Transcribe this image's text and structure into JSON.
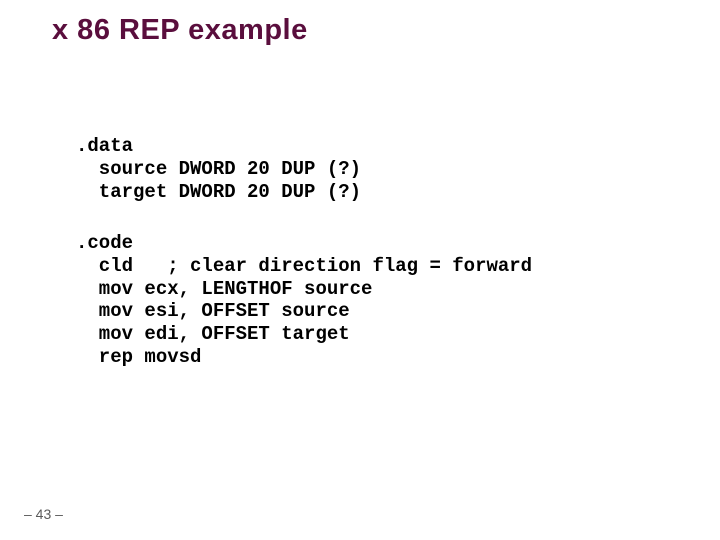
{
  "title": "x 86 REP example",
  "data_section": ".data\n  source DWORD 20 DUP (?)\n  target DWORD 20 DUP (?)",
  "code_section": ".code\n  cld   ; clear direction flag = forward\n  mov ecx, LENGTHOF source\n  mov esi, OFFSET source\n  mov edi, OFFSET target\n  rep movsd",
  "page_number": "– 43 –"
}
